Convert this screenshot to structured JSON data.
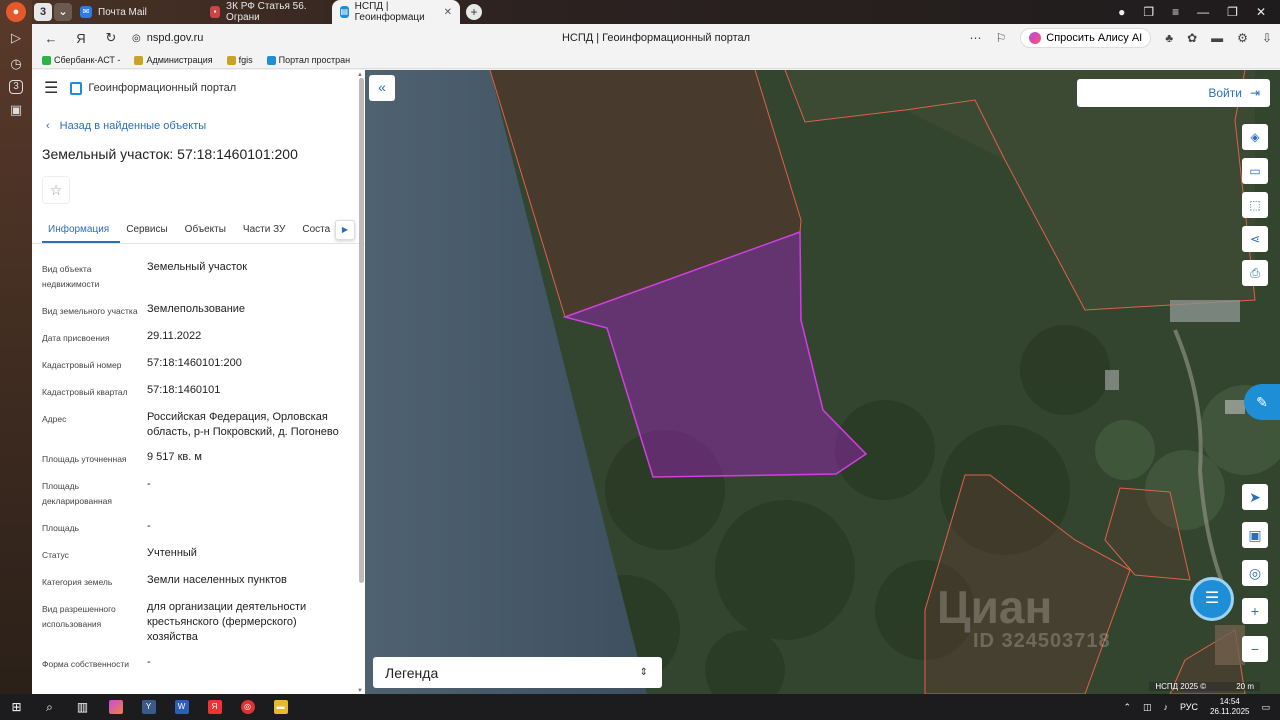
{
  "browser": {
    "tabs": [
      {
        "label": "Почта Mail"
      },
      {
        "label": "ЗК РФ Статья 56. Ограни"
      },
      {
        "label": "НСПД | Геоинформаци"
      }
    ],
    "tab_count_badge": "3",
    "url": "nspd.gov.ru",
    "page_title": "НСПД | Геоинформационный портал",
    "alisa_label": "Спросить Алису AI",
    "bookmarks": [
      {
        "label": "Сбербанк-АСТ - "
      },
      {
        "label": "Администрация "
      },
      {
        "label": "fgis"
      },
      {
        "label": "Портал простран"
      }
    ]
  },
  "panel": {
    "portal_name": "Геоинформационный портал",
    "back_label": "Назад в найденные объекты",
    "title": "Земельный участок: 57:18:1460101:200",
    "tabs": [
      "Информация",
      "Сервисы",
      "Объекты",
      "Части ЗУ",
      "Соста"
    ],
    "properties": [
      {
        "key": "Вид объекта недвижимости",
        "value": "Земельный участок"
      },
      {
        "key": "Вид земельного участка",
        "value": "Землепользование"
      },
      {
        "key": "Дата присвоения",
        "value": "29.11.2022"
      },
      {
        "key": "Кадастровый номер",
        "value": "57:18:1460101:200"
      },
      {
        "key": "Кадастровый квартал",
        "value": "57:18:1460101"
      },
      {
        "key": "Адрес",
        "value": "Российская Федерация, Орловская область, р-н Покровский, д. Погонево"
      },
      {
        "key": "Площадь уточненная",
        "value": "9 517 кв. м"
      },
      {
        "key": "Площадь декларированная",
        "value": "-"
      },
      {
        "key": "Площадь",
        "value": "-"
      },
      {
        "key": "Статус",
        "value": "Учтенный"
      },
      {
        "key": "Категория земель",
        "value": "Земли населенных пунктов"
      },
      {
        "key": "Вид разрешенного использования",
        "value": "для организации деятельности крестьянского (фермерского) хозяйства"
      },
      {
        "key": "Форма собственности",
        "value": "-"
      }
    ]
  },
  "map": {
    "login_label": "Войти",
    "legend_label": "Легенда",
    "watermark_brand": "Циан",
    "watermark_id": "ID 324503718",
    "attribution": "НСПД 2025 ©",
    "scale_label": "20 m",
    "colors": {
      "selected_fill": "#a020c0",
      "selected_stroke": "#d040e0",
      "parcel_stroke": "#e0604a",
      "accent": "#1e8fd6"
    }
  },
  "taskbar": {
    "lang": "РУС",
    "time": "14:54",
    "date": "26.11.2025"
  }
}
